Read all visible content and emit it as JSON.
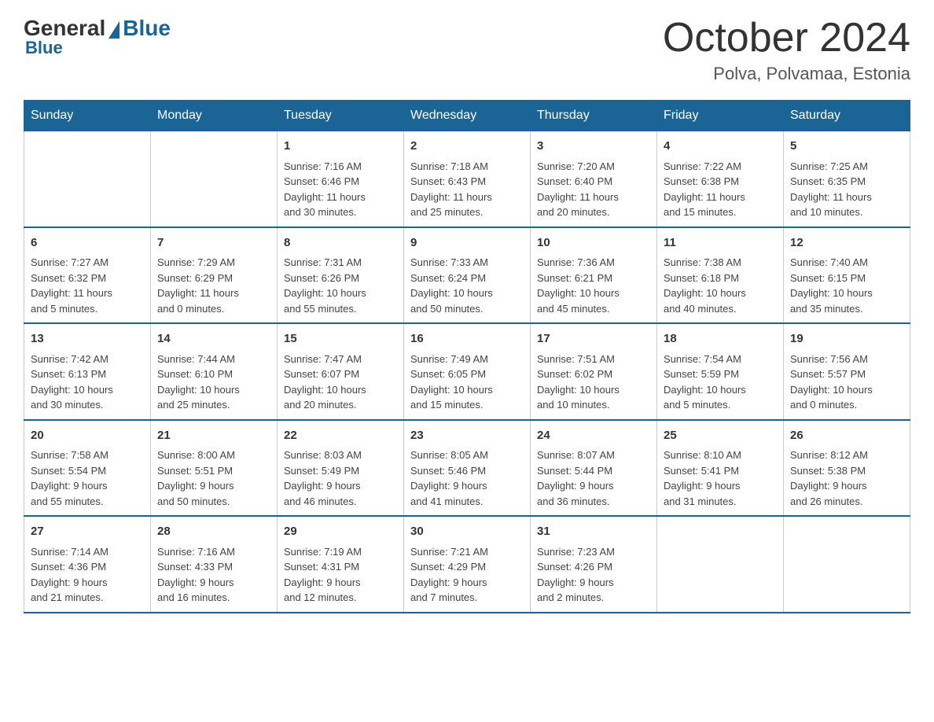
{
  "logo": {
    "general": "General",
    "blue": "Blue",
    "bottom": "Blue"
  },
  "header": {
    "month_title": "October 2024",
    "location": "Polva, Polvamaa, Estonia"
  },
  "days_of_week": [
    "Sunday",
    "Monday",
    "Tuesday",
    "Wednesday",
    "Thursday",
    "Friday",
    "Saturday"
  ],
  "weeks": [
    [
      {
        "day": "",
        "info": ""
      },
      {
        "day": "",
        "info": ""
      },
      {
        "day": "1",
        "info": "Sunrise: 7:16 AM\nSunset: 6:46 PM\nDaylight: 11 hours\nand 30 minutes."
      },
      {
        "day": "2",
        "info": "Sunrise: 7:18 AM\nSunset: 6:43 PM\nDaylight: 11 hours\nand 25 minutes."
      },
      {
        "day": "3",
        "info": "Sunrise: 7:20 AM\nSunset: 6:40 PM\nDaylight: 11 hours\nand 20 minutes."
      },
      {
        "day": "4",
        "info": "Sunrise: 7:22 AM\nSunset: 6:38 PM\nDaylight: 11 hours\nand 15 minutes."
      },
      {
        "day": "5",
        "info": "Sunrise: 7:25 AM\nSunset: 6:35 PM\nDaylight: 11 hours\nand 10 minutes."
      }
    ],
    [
      {
        "day": "6",
        "info": "Sunrise: 7:27 AM\nSunset: 6:32 PM\nDaylight: 11 hours\nand 5 minutes."
      },
      {
        "day": "7",
        "info": "Sunrise: 7:29 AM\nSunset: 6:29 PM\nDaylight: 11 hours\nand 0 minutes."
      },
      {
        "day": "8",
        "info": "Sunrise: 7:31 AM\nSunset: 6:26 PM\nDaylight: 10 hours\nand 55 minutes."
      },
      {
        "day": "9",
        "info": "Sunrise: 7:33 AM\nSunset: 6:24 PM\nDaylight: 10 hours\nand 50 minutes."
      },
      {
        "day": "10",
        "info": "Sunrise: 7:36 AM\nSunset: 6:21 PM\nDaylight: 10 hours\nand 45 minutes."
      },
      {
        "day": "11",
        "info": "Sunrise: 7:38 AM\nSunset: 6:18 PM\nDaylight: 10 hours\nand 40 minutes."
      },
      {
        "day": "12",
        "info": "Sunrise: 7:40 AM\nSunset: 6:15 PM\nDaylight: 10 hours\nand 35 minutes."
      }
    ],
    [
      {
        "day": "13",
        "info": "Sunrise: 7:42 AM\nSunset: 6:13 PM\nDaylight: 10 hours\nand 30 minutes."
      },
      {
        "day": "14",
        "info": "Sunrise: 7:44 AM\nSunset: 6:10 PM\nDaylight: 10 hours\nand 25 minutes."
      },
      {
        "day": "15",
        "info": "Sunrise: 7:47 AM\nSunset: 6:07 PM\nDaylight: 10 hours\nand 20 minutes."
      },
      {
        "day": "16",
        "info": "Sunrise: 7:49 AM\nSunset: 6:05 PM\nDaylight: 10 hours\nand 15 minutes."
      },
      {
        "day": "17",
        "info": "Sunrise: 7:51 AM\nSunset: 6:02 PM\nDaylight: 10 hours\nand 10 minutes."
      },
      {
        "day": "18",
        "info": "Sunrise: 7:54 AM\nSunset: 5:59 PM\nDaylight: 10 hours\nand 5 minutes."
      },
      {
        "day": "19",
        "info": "Sunrise: 7:56 AM\nSunset: 5:57 PM\nDaylight: 10 hours\nand 0 minutes."
      }
    ],
    [
      {
        "day": "20",
        "info": "Sunrise: 7:58 AM\nSunset: 5:54 PM\nDaylight: 9 hours\nand 55 minutes."
      },
      {
        "day": "21",
        "info": "Sunrise: 8:00 AM\nSunset: 5:51 PM\nDaylight: 9 hours\nand 50 minutes."
      },
      {
        "day": "22",
        "info": "Sunrise: 8:03 AM\nSunset: 5:49 PM\nDaylight: 9 hours\nand 46 minutes."
      },
      {
        "day": "23",
        "info": "Sunrise: 8:05 AM\nSunset: 5:46 PM\nDaylight: 9 hours\nand 41 minutes."
      },
      {
        "day": "24",
        "info": "Sunrise: 8:07 AM\nSunset: 5:44 PM\nDaylight: 9 hours\nand 36 minutes."
      },
      {
        "day": "25",
        "info": "Sunrise: 8:10 AM\nSunset: 5:41 PM\nDaylight: 9 hours\nand 31 minutes."
      },
      {
        "day": "26",
        "info": "Sunrise: 8:12 AM\nSunset: 5:38 PM\nDaylight: 9 hours\nand 26 minutes."
      }
    ],
    [
      {
        "day": "27",
        "info": "Sunrise: 7:14 AM\nSunset: 4:36 PM\nDaylight: 9 hours\nand 21 minutes."
      },
      {
        "day": "28",
        "info": "Sunrise: 7:16 AM\nSunset: 4:33 PM\nDaylight: 9 hours\nand 16 minutes."
      },
      {
        "day": "29",
        "info": "Sunrise: 7:19 AM\nSunset: 4:31 PM\nDaylight: 9 hours\nand 12 minutes."
      },
      {
        "day": "30",
        "info": "Sunrise: 7:21 AM\nSunset: 4:29 PM\nDaylight: 9 hours\nand 7 minutes."
      },
      {
        "day": "31",
        "info": "Sunrise: 7:23 AM\nSunset: 4:26 PM\nDaylight: 9 hours\nand 2 minutes."
      },
      {
        "day": "",
        "info": ""
      },
      {
        "day": "",
        "info": ""
      }
    ]
  ]
}
